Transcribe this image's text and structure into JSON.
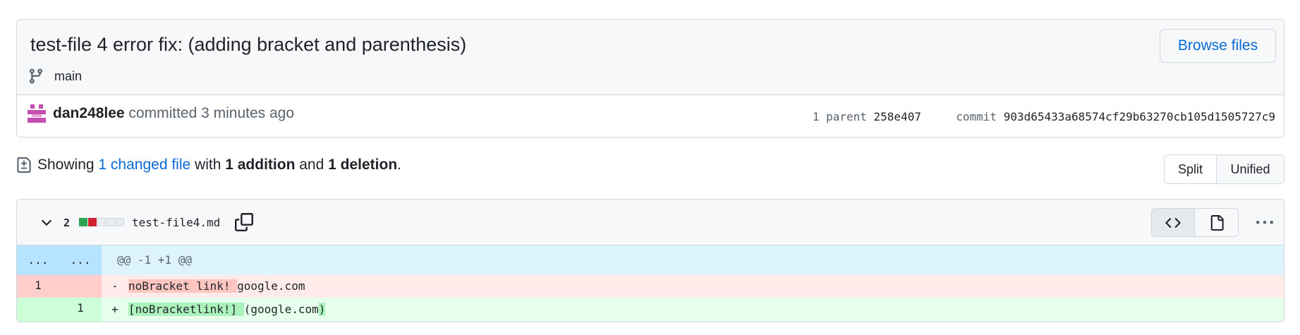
{
  "commit": {
    "title": "test-file 4 error fix: (adding bracket and parenthesis)",
    "branch": "main",
    "browse_label": "Browse files",
    "author": "dan248lee",
    "action": "committed",
    "time": "3 minutes ago",
    "parent_label": "1 parent",
    "parent_sha": "258e407",
    "commit_label": "commit",
    "commit_sha": "903d65433a68574cf29b63270cb105d1505727c9"
  },
  "summary": {
    "prefix": "Showing",
    "changed_files": "1 changed file",
    "with": "with",
    "additions": "1 addition",
    "and": "and",
    "deletions": "1 deletion",
    "suffix": "."
  },
  "view_toggle": {
    "split": "Split",
    "unified": "Unified",
    "selected": "Unified"
  },
  "file": {
    "change_count": "2",
    "name": "test-file4.md",
    "diffstat": [
      "add",
      "del",
      "neutral",
      "neutral",
      "neutral"
    ],
    "hunk": {
      "old_num": "...",
      "new_num": "...",
      "header": "@@ -1 +1 @@"
    },
    "deleted_line": {
      "old_num": "1",
      "new_num": "",
      "sign": "-",
      "changed": "noBracket link! ",
      "rest": "google.com"
    },
    "added_line": {
      "old_num": "",
      "new_num": "1",
      "sign": "+",
      "changed_1": "[noBracketlink!] ",
      "mid": "(google.com",
      "changed_2": ")"
    }
  },
  "icons": {
    "branch": "git-branch-icon",
    "file_diff": "file-diff-icon",
    "chevron": "chevron-down-icon",
    "copy": "copy-icon",
    "code": "code-icon",
    "file": "file-icon",
    "kebab": "kebab-horizontal-icon"
  },
  "colors": {
    "accent": "#0969da",
    "addition": "#2da44e",
    "deletion": "#cf222e",
    "neutral": "#eaeef2",
    "avatar": "#c44fb0"
  }
}
